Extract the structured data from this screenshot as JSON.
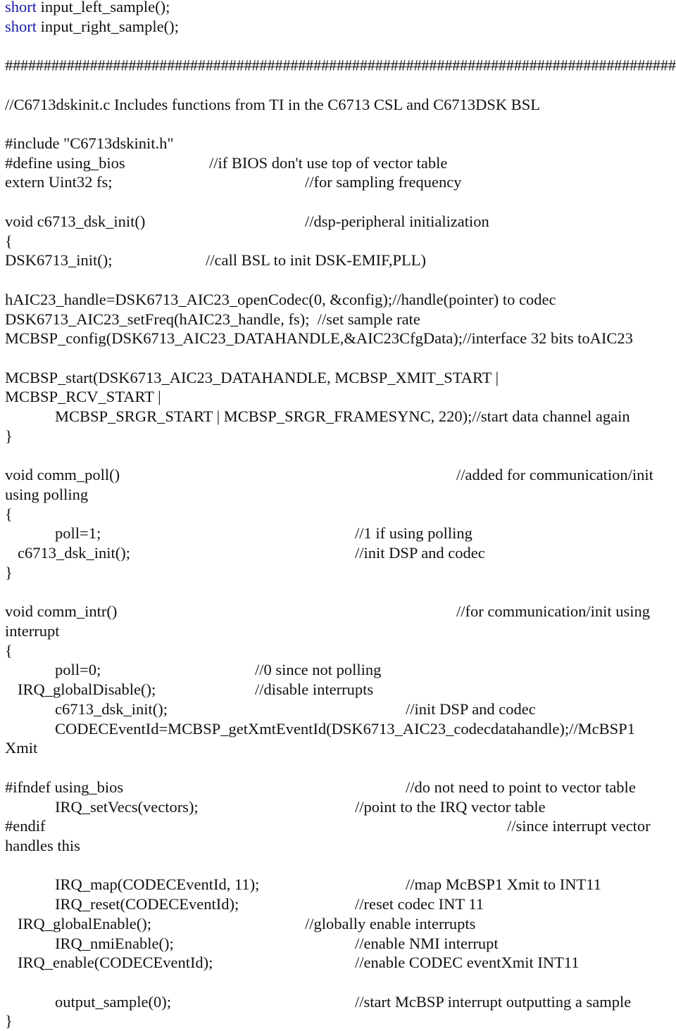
{
  "document": {
    "colors": {
      "text": "#111111",
      "keyword": "#1a1aa6",
      "background": "#ffffff"
    },
    "lines": [
      {
        "row": 0,
        "segments": [
          {
            "col": 7,
            "kw": "short",
            "text": " input_left_sample();"
          }
        ]
      },
      {
        "row": 1,
        "segments": [
          {
            "col": 7,
            "kw": "short",
            "text": " input_right_sample();"
          }
        ]
      },
      {
        "row": 3,
        "segments": [
          {
            "col": 7,
            "text": "##############################################################################################"
          }
        ]
      },
      {
        "row": 5,
        "segments": [
          {
            "col": 7,
            "text": "//C6713dskinit.c Includes functions from TI in the C6713 CSL and C6713DSK BSL"
          }
        ]
      },
      {
        "row": 7,
        "segments": [
          {
            "col": 7,
            "text": "#include \"C6713dskinit.h\""
          }
        ]
      },
      {
        "row": 8,
        "segments": [
          {
            "col": 7,
            "text": "#define using_bios"
          },
          {
            "col": 297,
            "text": "//if BIOS don't use top of vector table"
          }
        ]
      },
      {
        "row": 9,
        "segments": [
          {
            "col": 7,
            "text": "extern Uint32 fs;"
          },
          {
            "col": 433,
            "text": "//for sampling frequency"
          }
        ]
      },
      {
        "row": 11,
        "segments": [
          {
            "col": 7,
            "text": "void c6713_dsk_init()"
          },
          {
            "col": 433,
            "text": "//dsp-peripheral initialization"
          }
        ]
      },
      {
        "row": 12,
        "segments": [
          {
            "col": 7,
            "text": "{"
          }
        ]
      },
      {
        "row": 13,
        "segments": [
          {
            "col": 7,
            "text": "DSK6713_init();"
          },
          {
            "col": 292,
            "text": "//call BSL to init DSK-EMIF,PLL)"
          }
        ]
      },
      {
        "row": 15,
        "segments": [
          {
            "col": 7,
            "text": "hAIC23_handle=DSK6713_AIC23_openCodec(0, &config);//handle(pointer) to codec"
          }
        ]
      },
      {
        "row": 16,
        "segments": [
          {
            "col": 7,
            "text": "DSK6713_AIC23_setFreq(hAIC23_handle, fs);  //set sample rate"
          }
        ]
      },
      {
        "row": 17,
        "segments": [
          {
            "col": 7,
            "text": "MCBSP_config(DSK6713_AIC23_DATAHANDLE,&AIC23CfgData);//interface 32 bits toAIC23"
          }
        ]
      },
      {
        "row": 19,
        "segments": [
          {
            "col": 7,
            "text": "MCBSP_start(DSK6713_AIC23_DATAHANDLE, MCBSP_XMIT_START |"
          }
        ]
      },
      {
        "row": 20,
        "segments": [
          {
            "col": 7,
            "text": "MCBSP_RCV_START |"
          }
        ]
      },
      {
        "row": 21,
        "segments": [
          {
            "col": 78,
            "text": "MCBSP_SRGR_START | MCBSP_SRGR_FRAMESYNC, 220);//start data channel again"
          }
        ]
      },
      {
        "row": 22,
        "segments": [
          {
            "col": 7,
            "text": "}"
          }
        ]
      },
      {
        "row": 24,
        "segments": [
          {
            "col": 7,
            "text": "void comm_poll()"
          },
          {
            "col": 648,
            "text": "//added for communication/init"
          }
        ]
      },
      {
        "row": 25,
        "segments": [
          {
            "col": 7,
            "text": "using polling"
          }
        ]
      },
      {
        "row": 26,
        "segments": [
          {
            "col": 7,
            "text": "{"
          }
        ]
      },
      {
        "row": 27,
        "segments": [
          {
            "col": 78,
            "text": "poll=1;"
          },
          {
            "col": 504,
            "text": "//1 if using polling"
          }
        ]
      },
      {
        "row": 28,
        "segments": [
          {
            "col": 25,
            "text": "c6713_dsk_init();"
          },
          {
            "col": 504,
            "text": "//init DSP and codec"
          }
        ]
      },
      {
        "row": 29,
        "segments": [
          {
            "col": 7,
            "text": "}"
          }
        ]
      },
      {
        "row": 31,
        "segments": [
          {
            "col": 7,
            "text": "void comm_intr()"
          },
          {
            "col": 648,
            "text": "//for communication/init using"
          }
        ]
      },
      {
        "row": 32,
        "segments": [
          {
            "col": 7,
            "text": "interrupt"
          }
        ]
      },
      {
        "row": 33,
        "segments": [
          {
            "col": 7,
            "text": "{"
          }
        ]
      },
      {
        "row": 34,
        "segments": [
          {
            "col": 78,
            "text": "poll=0;"
          },
          {
            "col": 362,
            "text": "//0 since not polling"
          }
        ]
      },
      {
        "row": 35,
        "segments": [
          {
            "col": 25,
            "text": "IRQ_globalDisable();"
          },
          {
            "col": 362,
            "text": "//disable interrupts"
          }
        ]
      },
      {
        "row": 36,
        "segments": [
          {
            "col": 78,
            "text": "c6713_dsk_init();"
          },
          {
            "col": 576,
            "text": "//init DSP and codec"
          }
        ]
      },
      {
        "row": 37,
        "segments": [
          {
            "col": 78,
            "text": "CODECEventId=MCBSP_getXmtEventId(DSK6713_AIC23_codecdatahandle);//McBSP1"
          }
        ]
      },
      {
        "row": 38,
        "segments": [
          {
            "col": 7,
            "text": "Xmit"
          }
        ]
      },
      {
        "row": 40,
        "segments": [
          {
            "col": 7,
            "text": "#ifndef using_bios"
          },
          {
            "col": 576,
            "text": "//do not need to point to vector table"
          }
        ]
      },
      {
        "row": 41,
        "segments": [
          {
            "col": 78,
            "text": "IRQ_setVecs(vectors);"
          },
          {
            "col": 504,
            "text": "//point to the IRQ vector table"
          }
        ]
      },
      {
        "row": 42,
        "segments": [
          {
            "col": 7,
            "text": "#endif"
          },
          {
            "col": 720,
            "text": "//since interrupt vector"
          }
        ]
      },
      {
        "row": 43,
        "segments": [
          {
            "col": 7,
            "text": "handles this"
          }
        ]
      },
      {
        "row": 45,
        "segments": [
          {
            "col": 78,
            "text": "IRQ_map(CODECEventId, 11);"
          },
          {
            "col": 576,
            "text": "//map McBSP1 Xmit to INT11"
          }
        ]
      },
      {
        "row": 46,
        "segments": [
          {
            "col": 78,
            "text": "IRQ_reset(CODECEventId);"
          },
          {
            "col": 504,
            "text": "//reset codec INT 11"
          }
        ]
      },
      {
        "row": 47,
        "segments": [
          {
            "col": 25,
            "text": "IRQ_globalEnable();"
          },
          {
            "col": 433,
            "text": "//globally enable interrupts"
          }
        ]
      },
      {
        "row": 48,
        "segments": [
          {
            "col": 78,
            "text": "IRQ_nmiEnable();"
          },
          {
            "col": 504,
            "text": "//enable NMI interrupt"
          }
        ]
      },
      {
        "row": 49,
        "segments": [
          {
            "col": 25,
            "text": "IRQ_enable(CODECEventId);"
          },
          {
            "col": 504,
            "text": "//enable CODEC eventXmit INT11"
          }
        ]
      },
      {
        "row": 51,
        "segments": [
          {
            "col": 78,
            "text": "output_sample(0);"
          },
          {
            "col": 504,
            "text": "//start McBSP interrupt outputting a sample"
          }
        ]
      },
      {
        "row": 52,
        "segments": [
          {
            "col": 7,
            "text": "}"
          }
        ]
      }
    ]
  }
}
